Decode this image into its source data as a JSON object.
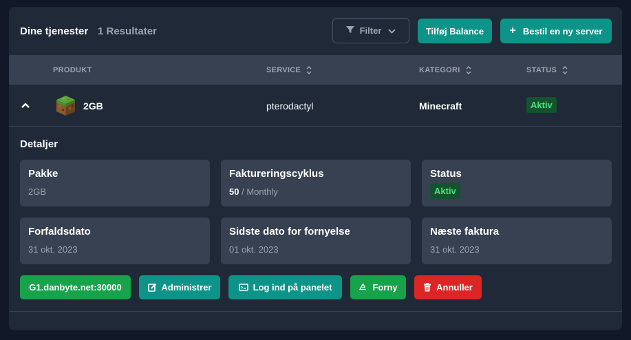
{
  "header": {
    "title": "Dine tjenester",
    "count": "1 Resultater"
  },
  "toolbar": {
    "filter_label": "Filter",
    "balance_label": "Tilføj Balance",
    "order_label": "Bestil en ny server"
  },
  "table": {
    "columns": [
      "PRODUKT",
      "SERVICE",
      "KATEGORI",
      "STATUS"
    ],
    "rows": [
      {
        "product": "2GB",
        "service": "pterodactyl",
        "category": "Minecraft",
        "status": "Aktiv"
      }
    ]
  },
  "details": {
    "title": "Detaljer",
    "package": {
      "label": "Pakke",
      "value": "2GB"
    },
    "billing": {
      "label": "Faktureringscyklus",
      "amount": "50",
      "cycle": "/ Monthly"
    },
    "status": {
      "label": "Status",
      "value": "Aktiv"
    },
    "due": {
      "label": "Forfaldsdato",
      "value": "31 okt. 2023"
    },
    "last_renewal": {
      "label": "Sidste dato for fornyelse",
      "value": "01 okt. 2023"
    },
    "next_invoice": {
      "label": "Næste faktura",
      "value": "31 okt. 2023"
    }
  },
  "actions": {
    "address": "G1.danbyte.net:30000",
    "manage": "Administrer",
    "login_panel": "Log ind på panelet",
    "renew": "Forny",
    "cancel": "Annuller"
  },
  "colors": {
    "teal": "#0d9488",
    "green": "#16a34a",
    "red": "#dc2626",
    "status_text": "#4ade80"
  }
}
